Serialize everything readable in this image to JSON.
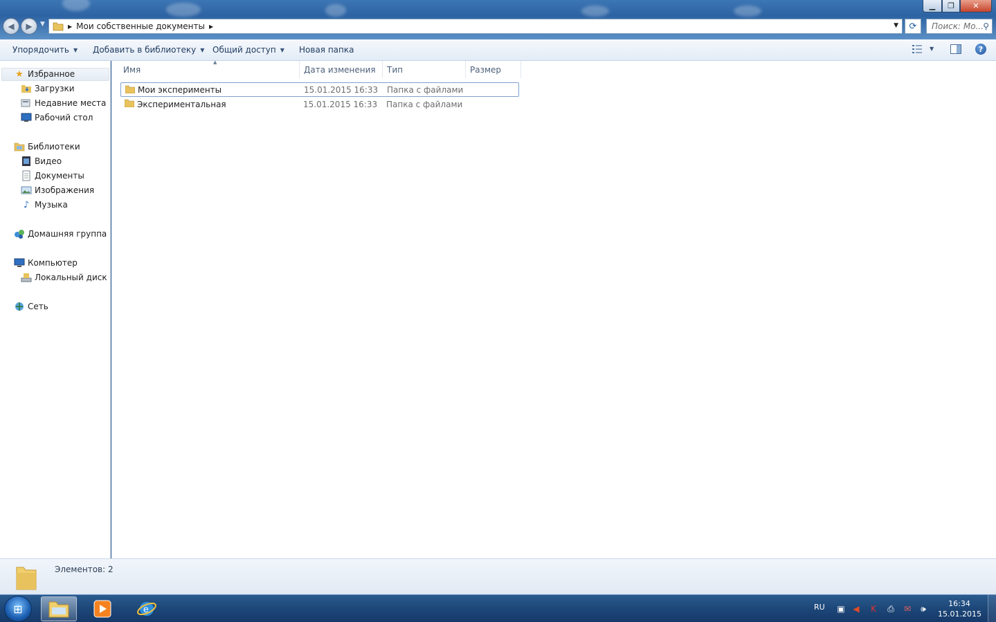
{
  "window": {
    "controls": {
      "minimize": "▁",
      "maximize": "❐",
      "close": "✕"
    }
  },
  "address": {
    "path": "Мои собственные документы",
    "refresh_icon": "refresh-icon"
  },
  "search": {
    "placeholder": "Поиск: Мо..."
  },
  "toolbar": {
    "organize": "Упорядочить",
    "add_to_library": "Добавить в библиотеку",
    "share": "Общий доступ",
    "new_folder": "Новая папка"
  },
  "nav": {
    "favorites": {
      "label": "Избранное",
      "icon": "star-icon"
    },
    "favorites_items": [
      {
        "label": "Загрузки",
        "icon": "downloads-icon"
      },
      {
        "label": "Недавние места",
        "icon": "recent-places-icon"
      },
      {
        "label": "Рабочий стол",
        "icon": "desktop-icon"
      }
    ],
    "libraries": {
      "label": "Библиотеки",
      "icon": "libraries-icon"
    },
    "libraries_items": [
      {
        "label": "Видео",
        "icon": "video-icon"
      },
      {
        "label": "Документы",
        "icon": "documents-icon"
      },
      {
        "label": "Изображения",
        "icon": "pictures-icon"
      },
      {
        "label": "Музыка",
        "icon": "music-icon"
      }
    ],
    "homegroup": {
      "label": "Домашняя группа",
      "icon": "homegroup-icon"
    },
    "computer": {
      "label": "Компьютер",
      "icon": "computer-icon"
    },
    "computer_items": [
      {
        "label": "Локальный диск (C:)",
        "icon": "drive-icon"
      }
    ],
    "network": {
      "label": "Сеть",
      "icon": "network-icon"
    }
  },
  "columns": {
    "name": "Имя",
    "date": "Дата изменения",
    "type": "Тип",
    "size": "Размер"
  },
  "files": [
    {
      "name": "Мои эксперименты",
      "date": "15.01.2015 16:33",
      "type": "Папка с файлами",
      "selected": true
    },
    {
      "name": "Экспериментальная",
      "date": "15.01.2015 16:33",
      "type": "Папка с файлами",
      "selected": false
    }
  ],
  "details": {
    "count_text": "Элементов: 2"
  },
  "taskbar": {
    "apps": [
      "explorer-icon",
      "media-player-icon",
      "internet-explorer-icon"
    ],
    "language": "RU",
    "time": "16:34",
    "date": "15.01.2015"
  },
  "colors": {
    "accent": "#1e4f8c",
    "selection_border": "#7da2ce",
    "folder": "#e8c25c"
  }
}
